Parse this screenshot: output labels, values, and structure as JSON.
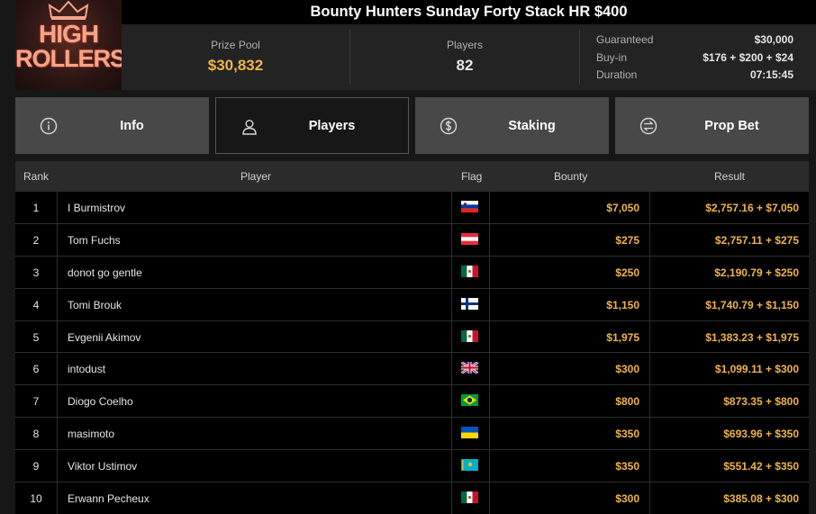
{
  "logo": {
    "line1": "HIGH",
    "line2": "ROLLERS"
  },
  "title": "Bounty Hunters Sunday Forty Stack HR $400",
  "stats": {
    "prize_pool_label": "Prize Pool",
    "prize_pool_value": "$30,832",
    "players_label": "Players",
    "players_value": "82"
  },
  "details": [
    {
      "key": "Guaranteed",
      "value": "$30,000"
    },
    {
      "key": "Buy-in",
      "value": "$176 + $200 + $24"
    },
    {
      "key": "Duration",
      "value": "07:15:45"
    }
  ],
  "tabs": [
    {
      "label": "Info",
      "icon": "info-icon",
      "active": false
    },
    {
      "label": "Players",
      "icon": "person-icon",
      "active": true
    },
    {
      "label": "Staking",
      "icon": "dollar-icon",
      "active": false
    },
    {
      "label": "Prop Bet",
      "icon": "prop-bet-icon",
      "active": false
    }
  ],
  "table": {
    "headers": {
      "rank": "Rank",
      "player": "Player",
      "flag": "Flag",
      "bounty": "Bounty",
      "result": "Result"
    },
    "rows": [
      {
        "rank": "1",
        "player": "I Burmistrov",
        "flag": "slovenia",
        "bounty": "$7,050",
        "result": "$2,757.16 + $7,050"
      },
      {
        "rank": "2",
        "player": "Tom Fuchs",
        "flag": "austria",
        "bounty": "$275",
        "result": "$2,757.11 + $275"
      },
      {
        "rank": "3",
        "player": "donot go gentle",
        "flag": "mexico",
        "bounty": "$250",
        "result": "$2,190.79 + $250"
      },
      {
        "rank": "4",
        "player": "Tomi Brouk",
        "flag": "finland",
        "bounty": "$1,150",
        "result": "$1,740.79 + $1,150"
      },
      {
        "rank": "5",
        "player": "Evgenii Akimov",
        "flag": "mexico",
        "bounty": "$1,975",
        "result": "$1,383.23 + $1,975"
      },
      {
        "rank": "6",
        "player": "intodust",
        "flag": "uk",
        "bounty": "$300",
        "result": "$1,099.11 + $300"
      },
      {
        "rank": "7",
        "player": "Diogo Coelho",
        "flag": "brazil",
        "bounty": "$800",
        "result": "$873.35 + $800"
      },
      {
        "rank": "8",
        "player": "masimoto",
        "flag": "ukraine",
        "bounty": "$350",
        "result": "$693.96 + $350"
      },
      {
        "rank": "9",
        "player": "Viktor Ustimov",
        "flag": "kazakhstan",
        "bounty": "$350",
        "result": "$551.42 + $350"
      },
      {
        "rank": "10",
        "player": "Erwann Pecheux",
        "flag": "mexico",
        "bounty": "$300",
        "result": "$385.08 + $300"
      }
    ]
  },
  "colors": {
    "accent": "#f0b44c",
    "tab_bg": "#484848",
    "row_bg": "#000000",
    "header_bg": "#2b2b2b"
  }
}
